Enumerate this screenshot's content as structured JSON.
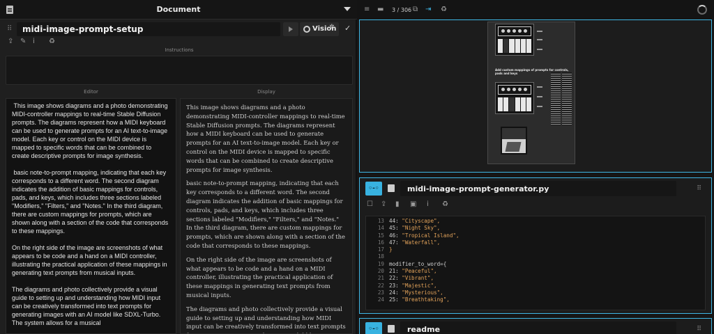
{
  "left": {
    "doc_title": "Document",
    "node_name": "midi-image-prompt-setup",
    "vision_label": "Vision",
    "instructions_label": "Instructions",
    "instructions_value": "",
    "editor_label": "Editor",
    "display_label": "Display",
    "editor_text": " This image shows diagrams and a photo demonstrating MIDI-controller mappings to real-time Stable Diffusion prompts. The diagrams represent how a MIDI keyboard can be used to generate prompts for an AI text-to-image model. Each key or control on the MIDI device is mapped to specific words that can be combined to create descriptive prompts for image synthesis.\n\n basic note-to-prompt mapping, indicating that each key corresponds to a different word. The second diagram indicates the addition of basic mappings for controls, pads, and keys, which includes three sections labeled \"Modifiers,\" \"Filters,\" and \"Notes.\" In the third diagram, there are custom mappings for prompts, which are shown along with a section of the code that corresponds to these mappings.\n\nOn the right side of the image are screenshots of what appears to be code and a hand on a MIDI controller, illustrating the practical application of these mappings in generating text prompts from musical inputs.\n\nThe diagrams and photo collectively provide a visual guide to setting up and understanding how MIDI input can be creatively transformed into text prompts for generating images with an AI model like SDXL-Turbo. The system allows for a musical",
    "display_paragraphs": [
      "This image shows diagrams and a photo demonstrating MIDI-controller mappings to real-time Stable Diffusion prompts. The diagrams represent how a MIDI keyboard can be used to generate prompts for an AI text-to-image model. Each key or control on the MIDI device is mapped to specific words that can be combined to create descriptive prompts for image synthesis.",
      "basic note-to-prompt mapping, indicating that each key corresponds to a different word. The second diagram indicates the addition of basic mappings for controls, pads, and keys, which includes three sections labeled \"Modifiers,\" \"Filters,\" and \"Notes.\" In the third diagram, there are custom mappings for prompts, which are shown along with a section of the code that corresponds to these mappings.",
      "On the right side of the image are screenshots of what appears to be code and a hand on a MIDI controller, illustrating the practical application of these mappings in generating text prompts from musical inputs.",
      "The diagrams and photo collectively provide a visual guide to setting up and understanding how MIDI input can be creatively transformed into text prompts for generating images with an AI model like SDXL-Turbo. The system allows for a musical"
    ]
  },
  "right": {
    "pager": "3 / 306",
    "preview_caption": "Add custom mappings of prompts for controls, pads and keys",
    "code_card": {
      "tag": "◦-◦",
      "filename": "midi-image-prompt-generator.py",
      "lines": [
        {
          "n": "13",
          "t": "44: ",
          "s": "\"Cityscape\","
        },
        {
          "n": "14",
          "t": "45: ",
          "s": "\"Night Sky\","
        },
        {
          "n": "15",
          "t": "46: ",
          "s": "\"Tropical Island\","
        },
        {
          "n": "16",
          "t": "47: ",
          "s": "\"Waterfall\","
        },
        {
          "n": "17",
          "t": "",
          "s": "}"
        },
        {
          "n": "18",
          "t": "",
          "s": ""
        },
        {
          "n": "19",
          "t": "modifier_to_word={",
          "s": ""
        },
        {
          "n": "20",
          "t": "21: ",
          "s": "\"Peaceful\","
        },
        {
          "n": "21",
          "t": "22: ",
          "s": "\"Vibrant\","
        },
        {
          "n": "22",
          "t": "23: ",
          "s": "\"Majestic\","
        },
        {
          "n": "23",
          "t": "24: ",
          "s": "\"Mysterious\","
        },
        {
          "n": "24",
          "t": "25: ",
          "s": "\"Breathtaking\","
        }
      ]
    },
    "readme_card": {
      "tag": "◦-◦",
      "filename": "readme"
    }
  },
  "colors": {
    "accent": "#3fb7e6",
    "string": "#e3a35a",
    "background": "#161616"
  }
}
